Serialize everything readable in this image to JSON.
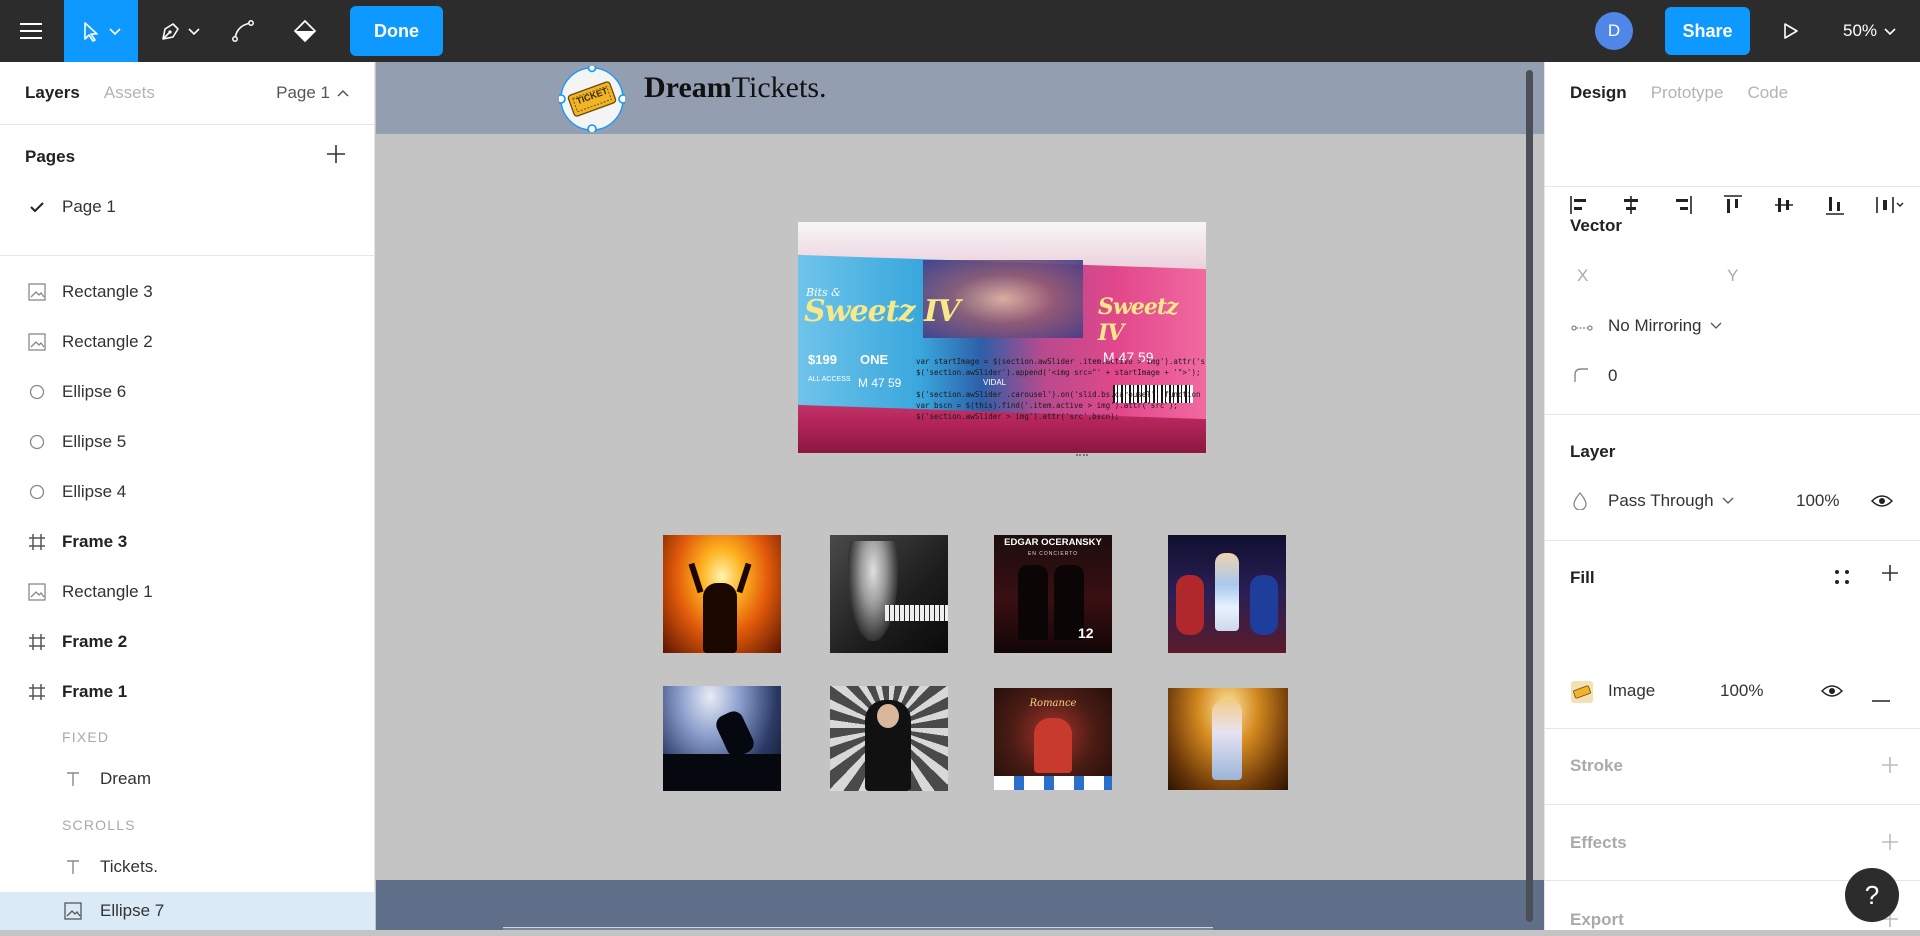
{
  "toolbar": {
    "done_label": "Done",
    "share_label": "Share",
    "avatar_letter": "D",
    "zoom": "50%"
  },
  "left": {
    "tabs": [
      "Layers",
      "Assets"
    ],
    "page_selector": "Page 1",
    "pages_title": "Pages",
    "pages": [
      "Page 1"
    ],
    "layers": [
      "Rectangle 3",
      "Rectangle 2",
      "Ellipse 6",
      "Ellipse 5",
      "Ellipse 4",
      "Frame 3",
      "Rectangle 1",
      "Frame 2",
      "Frame 1"
    ],
    "fixed_label": "FIXED",
    "fixed_item": "Dream",
    "scrolls_label": "SCROLLS",
    "scroll_items": [
      "Tickets.",
      "Ellipse 7"
    ]
  },
  "canvas": {
    "brand_bold": "Dream",
    "brand_rest": "Tickets.",
    "logo_text": "TICKET",
    "ticket": {
      "title_line1": "Bits &",
      "title_line2": "Sweetz IV",
      "price": "$199",
      "section": "ONE",
      "seat_row": "M  47  59",
      "access": "ALL ACCESS",
      "name": "VIDAL",
      "code1": "var startImage = $(section.awSlider .item.active > img').attr('src');",
      "code2": "$('section.awSlider').append('<img src=\"' + startImage + '\">');",
      "code3": "$('section.awSlider .carousel').on('slid.bs.carousel', function () {",
      "code4": "var bscn = $(this).find('.item.active > img').attr('src');",
      "code5": "$('section.awSlider > img').attr('src',bscn);"
    },
    "poster_title": "EDGAR OCERANSKY",
    "poster_sub": "EN CONCIERTO",
    "poster_date": "12",
    "poster2_title": "Romance"
  },
  "right": {
    "tabs": [
      "Design",
      "Prototype",
      "Code"
    ],
    "vector_title": "Vector",
    "x_label": "X",
    "y_label": "Y",
    "mirroring": "No Mirroring",
    "corner_radius": "0",
    "layer_title": "Layer",
    "blend_mode": "Pass Through",
    "layer_opacity": "100%",
    "fill_title": "Fill",
    "fill_type": "Image",
    "fill_opacity": "100%",
    "stroke_title": "Stroke",
    "effects_title": "Effects",
    "export_title": "Export",
    "help": "?"
  }
}
